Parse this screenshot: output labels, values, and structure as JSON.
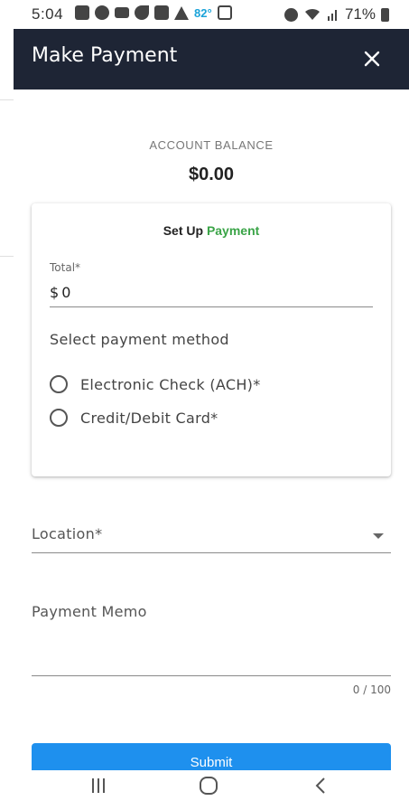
{
  "status_bar": {
    "time": "5:04",
    "temperature": "82°",
    "battery": "71%"
  },
  "header": {
    "title": "Make Payment",
    "close_icon": "close-icon"
  },
  "balance": {
    "label": "ACCOUNT BALANCE",
    "value": "$0.00"
  },
  "payment_card": {
    "title_prefix": "Set Up",
    "title_accent": "Payment",
    "accent_color": "#3aa447",
    "total_label": "Total*",
    "currency_symbol": "$",
    "total_value": "0",
    "method_label": "Select payment method",
    "methods": [
      {
        "label": "Electronic Check (ACH)*",
        "selected": false
      },
      {
        "label": "Credit/Debit Card*",
        "selected": false
      }
    ]
  },
  "location": {
    "label": "Location*"
  },
  "memo": {
    "label": "Payment Memo",
    "value": "",
    "counter": "0 / 100"
  },
  "submit": {
    "label": "Submit",
    "color": "#1e90ee"
  },
  "nav": {
    "recent_icon": "recent-apps-icon",
    "home_icon": "home-icon",
    "back_icon": "back-icon"
  }
}
